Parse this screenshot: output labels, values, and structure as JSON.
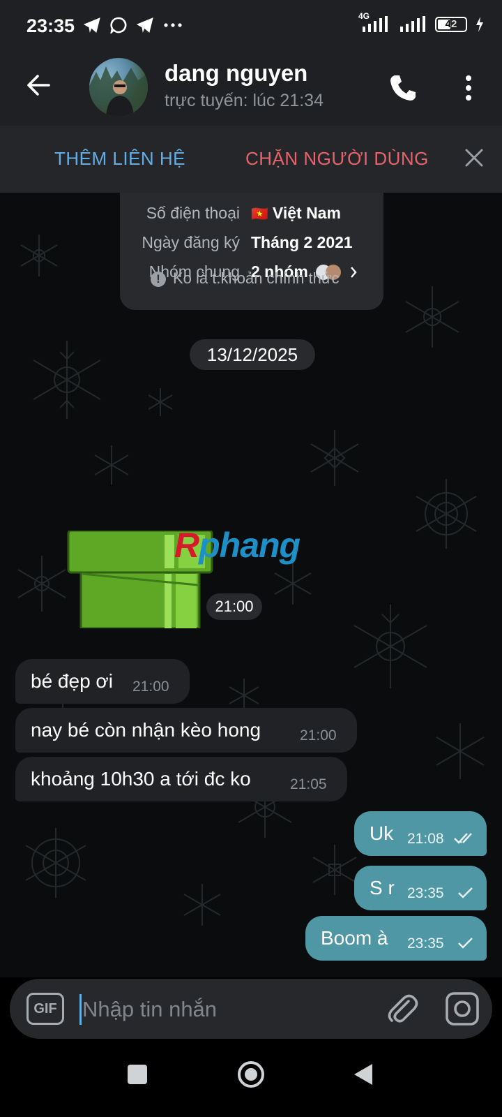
{
  "status_bar": {
    "time": "23:35",
    "network": "4G",
    "battery": "42",
    "icons": [
      "telegram-icon",
      "whatsapp-icon",
      "telegram-icon",
      "more-notifications-icon",
      "signal-icon",
      "signal-icon",
      "battery-icon",
      "charging-icon"
    ]
  },
  "header": {
    "name": "dang nguyen",
    "status": "trực tuyến: lúc 21:34"
  },
  "action_bar": {
    "add_contact": "THÊM LIÊN HỆ",
    "block_user": "CHẶN NGƯỜI DÙNG"
  },
  "info_card": {
    "rows": [
      {
        "label": "Số điện thoại",
        "value": "Việt Nam",
        "flag": "🇻🇳"
      },
      {
        "label": "Ngày đăng ký",
        "value": "Tháng 2 2021"
      },
      {
        "label": "Nhóm chung",
        "value": "2 nhóm"
      }
    ],
    "notice": "Ko là t.khoản chính thức"
  },
  "date_separator": "13/12/2025",
  "watermark": {
    "first": "R",
    "rest": "phang"
  },
  "sticker": {
    "time": "21:00"
  },
  "incoming": [
    {
      "text": "bé đẹp ơi",
      "time": "21:00"
    },
    {
      "text": "nay bé còn nhận kèo hong",
      "time": "21:00"
    },
    {
      "text": "khoảng 10h30 a tới đc ko",
      "time": "21:05"
    }
  ],
  "outgoing": [
    {
      "text": "Uk",
      "time": "21:08",
      "status": "read"
    },
    {
      "text": "S r",
      "time": "23:35",
      "status": "sent"
    },
    {
      "text": "Boom à",
      "time": "23:35",
      "status": "sent"
    }
  ],
  "composer": {
    "gif": "GIF",
    "placeholder": "Nhập tin nhắn"
  },
  "colors": {
    "accent": "#64aee6",
    "danger": "#e9636b",
    "outgoing_bubble": "#4f97a5",
    "incoming_bubble": "#212225"
  }
}
